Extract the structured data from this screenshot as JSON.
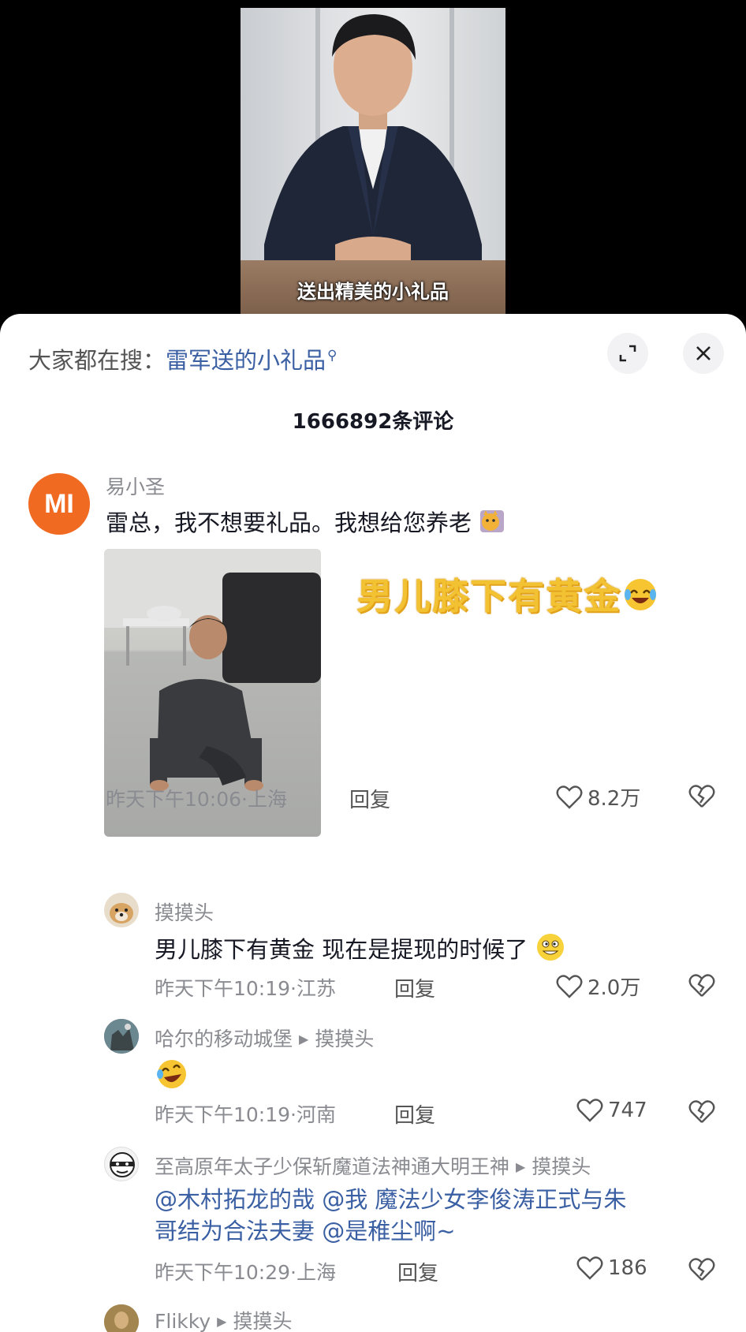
{
  "video": {
    "caption": "送出精美的小礼品"
  },
  "panel": {
    "search_prefix": "大家都在搜：",
    "search_term": "雷军送的小礼品",
    "comment_count": "1666892条评论"
  },
  "comments": [
    {
      "username": "易小圣",
      "text": "雷总，我不想要礼品。我想给您养老",
      "image_sticker_text": "男儿膝下有黄金",
      "time_location": "昨天下午10:06·上海",
      "reply_label": "回复",
      "likes": "8.2万"
    },
    {
      "username": "摸摸头",
      "text": "男儿膝下有黄金 现在是提现的时候了",
      "time_location": "昨天下午10:19·江苏",
      "reply_label": "回复",
      "likes": "2.0万"
    },
    {
      "username": "哈尔的移动城堡",
      "reply_to": "摸摸头",
      "time_location": "昨天下午10:19·河南",
      "reply_label": "回复",
      "likes": "747"
    },
    {
      "username": "至高原年太子少保斩魔道法神通大明王神",
      "reply_to": "摸摸头",
      "text_line1": "@木村拓龙的哉 @我 魔法少女李俊涛正式与朱",
      "text_line2": "哥结为合法夫妻 @是稚尘啊~",
      "time_location": "昨天下午10:29·上海",
      "reply_label": "回复",
      "likes": "186"
    },
    {
      "username": "Flikky",
      "reply_to": "摸摸头"
    }
  ],
  "icons": {
    "logo_text": "MI",
    "brand_color": "#f06a22",
    "link_color": "#3a5fa3"
  }
}
